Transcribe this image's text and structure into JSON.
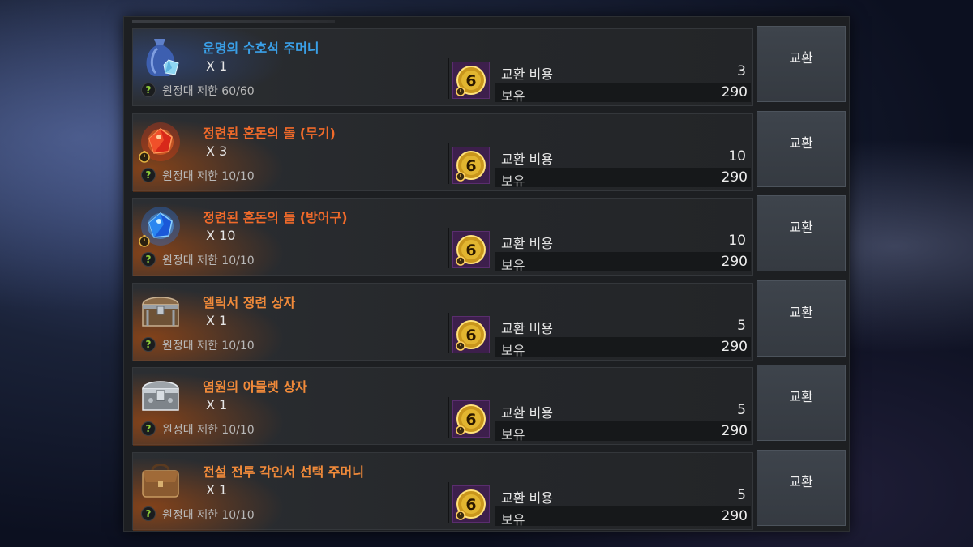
{
  "exchange": {
    "cost_label": "교환 비용",
    "have_label": "보유",
    "button_label": "교환",
    "help_glyph": "?",
    "items": [
      {
        "name": "운명의 수호석 주머니",
        "name_color": "#3aa0e8",
        "qty": "X 1",
        "limit": "원정대 제한 60/60",
        "cost": "3",
        "have": "290",
        "icon": "blue-pouch-icon",
        "glow": "blue",
        "timed": false
      },
      {
        "name": "정련된 혼돈의 돌 (무기)",
        "name_color": "#f06a2a",
        "qty": "X 3",
        "limit": "원정대 제한 10/10",
        "cost": "10",
        "have": "290",
        "icon": "red-chaos-stone-icon",
        "glow": "orange",
        "timed": true
      },
      {
        "name": "정련된 혼돈의 돌 (방어구)",
        "name_color": "#f06a2a",
        "qty": "X 10",
        "limit": "원정대 제한 10/10",
        "cost": "10",
        "have": "290",
        "icon": "blue-chaos-stone-icon",
        "glow": "orange",
        "timed": true
      },
      {
        "name": "엘릭서 정련 상자",
        "name_color": "#f08a3a",
        "qty": "X 1",
        "limit": "원정대 제한 10/10",
        "cost": "5",
        "have": "290",
        "icon": "wooden-chest-icon",
        "glow": "orange",
        "timed": false
      },
      {
        "name": "염원의 아뮬렛 상자",
        "name_color": "#f08a3a",
        "qty": "X 1",
        "limit": "원정대 제한 10/10",
        "cost": "5",
        "have": "290",
        "icon": "silver-chest-icon",
        "glow": "orange",
        "timed": false
      },
      {
        "name": "전설 전투 각인서 선택 주머니",
        "name_color": "#f08a3a",
        "qty": "X 1",
        "limit": "원정대 제한 10/10",
        "cost": "5",
        "have": "290",
        "icon": "leather-bag-icon",
        "glow": "orange",
        "timed": false
      }
    ]
  }
}
